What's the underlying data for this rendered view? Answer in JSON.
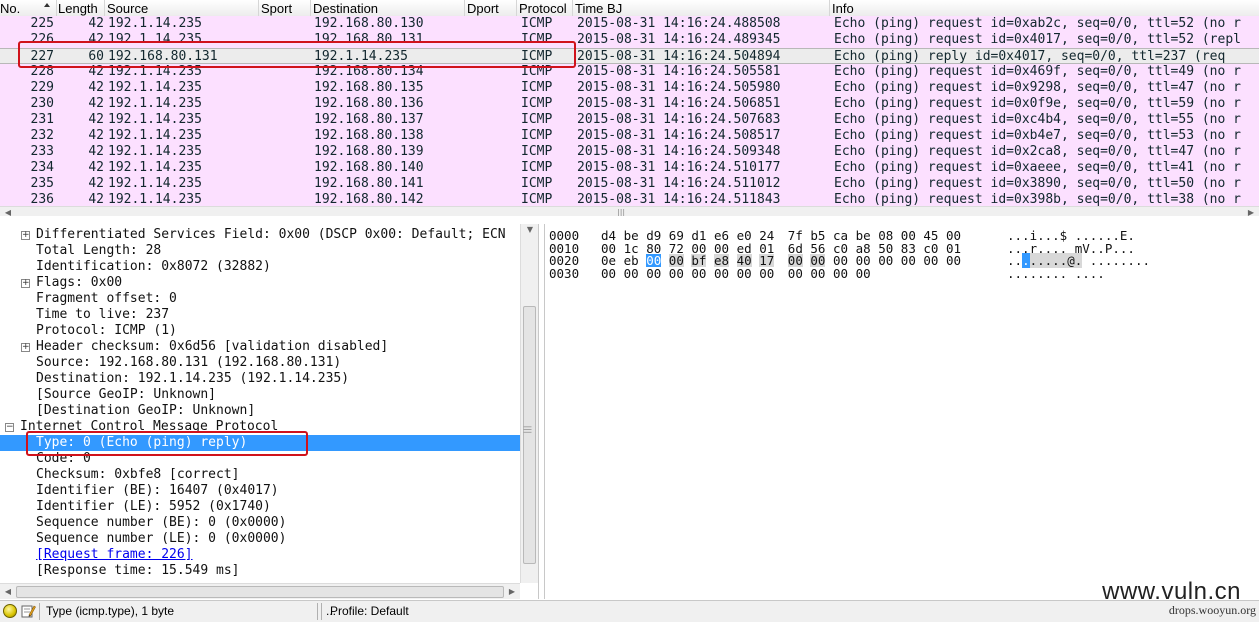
{
  "packet_list": {
    "columns": [
      "No.",
      "Length",
      "Source",
      "Sport",
      "Destination",
      "Dport",
      "Protocol",
      "Time BJ",
      "Info"
    ],
    "rows": [
      {
        "no": "225",
        "len": "42",
        "src": "192.1.14.235",
        "dst": "192.168.80.130",
        "proto": "ICMP",
        "time": "2015-08-31 14:16:24.488508",
        "info": "Echo (ping) request  id=0xab2c, seq=0/0, ttl=52 (no r"
      },
      {
        "no": "226",
        "len": "42",
        "src": "192.1.14.235",
        "dst": "192.168.80.131",
        "proto": "ICMP",
        "time": "2015-08-31 14:16:24.489345",
        "info": "Echo (ping) request  id=0x4017, seq=0/0, ttl=52 (repl"
      },
      {
        "no": "227",
        "len": "60",
        "src": "192.168.80.131",
        "dst": "192.1.14.235",
        "proto": "ICMP",
        "time": "2015-08-31 14:16:24.504894",
        "info": "Echo (ping) reply    id=0x4017, seq=0/0, ttl=237 (req"
      },
      {
        "no": "228",
        "len": "42",
        "src": "192.1.14.235",
        "dst": "192.168.80.134",
        "proto": "ICMP",
        "time": "2015-08-31 14:16:24.505581",
        "info": "Echo (ping) request  id=0x469f, seq=0/0, ttl=49 (no r"
      },
      {
        "no": "229",
        "len": "42",
        "src": "192.1.14.235",
        "dst": "192.168.80.135",
        "proto": "ICMP",
        "time": "2015-08-31 14:16:24.505980",
        "info": "Echo (ping) request  id=0x9298, seq=0/0, ttl=47 (no r"
      },
      {
        "no": "230",
        "len": "42",
        "src": "192.1.14.235",
        "dst": "192.168.80.136",
        "proto": "ICMP",
        "time": "2015-08-31 14:16:24.506851",
        "info": "Echo (ping) request  id=0x0f9e, seq=0/0, ttl=59 (no r"
      },
      {
        "no": "231",
        "len": "42",
        "src": "192.1.14.235",
        "dst": "192.168.80.137",
        "proto": "ICMP",
        "time": "2015-08-31 14:16:24.507683",
        "info": "Echo (ping) request  id=0xc4b4, seq=0/0, ttl=55 (no r"
      },
      {
        "no": "232",
        "len": "42",
        "src": "192.1.14.235",
        "dst": "192.168.80.138",
        "proto": "ICMP",
        "time": "2015-08-31 14:16:24.508517",
        "info": "Echo (ping) request  id=0xb4e7, seq=0/0, ttl=53 (no r"
      },
      {
        "no": "233",
        "len": "42",
        "src": "192.1.14.235",
        "dst": "192.168.80.139",
        "proto": "ICMP",
        "time": "2015-08-31 14:16:24.509348",
        "info": "Echo (ping) request  id=0x2ca8, seq=0/0, ttl=47 (no r"
      },
      {
        "no": "234",
        "len": "42",
        "src": "192.1.14.235",
        "dst": "192.168.80.140",
        "proto": "ICMP",
        "time": "2015-08-31 14:16:24.510177",
        "info": "Echo (ping) request  id=0xaeee, seq=0/0, ttl=41 (no r"
      },
      {
        "no": "235",
        "len": "42",
        "src": "192.1.14.235",
        "dst": "192.168.80.141",
        "proto": "ICMP",
        "time": "2015-08-31 14:16:24.511012",
        "info": "Echo (ping) request  id=0x3890, seq=0/0, ttl=50 (no r"
      },
      {
        "no": "236",
        "len": "42",
        "src": "192.1.14.235",
        "dst": "192.168.80.142",
        "proto": "ICMP",
        "time": "2015-08-31 14:16:24.511843",
        "info": "Echo (ping) request  id=0x398b, seq=0/0, ttl=38 (no r"
      }
    ],
    "selected_row": "227",
    "row_color": "#fce0ff"
  },
  "details": {
    "lines": [
      {
        "text": "Differentiated Services Field: 0x00 (DSCP 0x00: Default; ECN",
        "expander": "+",
        "level": 1
      },
      {
        "text": "Total Length: 28",
        "level": 1
      },
      {
        "text": "Identification: 0x8072 (32882)",
        "level": 1
      },
      {
        "text": "Flags: 0x00",
        "expander": "+",
        "level": 1
      },
      {
        "text": "Fragment offset: 0",
        "level": 1
      },
      {
        "text": "Time to live: 237",
        "level": 1
      },
      {
        "text": "Protocol: ICMP (1)",
        "level": 1
      },
      {
        "text": "Header checksum: 0x6d56 [validation disabled]",
        "expander": "+",
        "level": 1
      },
      {
        "text": "Source: 192.168.80.131 (192.168.80.131)",
        "level": 1
      },
      {
        "text": "Destination: 192.1.14.235 (192.1.14.235)",
        "level": 1
      },
      {
        "text": "[Source GeoIP: Unknown]",
        "level": 1
      },
      {
        "text": "[Destination GeoIP: Unknown]",
        "level": 1
      },
      {
        "text": "Internet Control Message Protocol",
        "expander": "−",
        "level": 0
      },
      {
        "text": "Type: 0 (Echo (ping) reply)",
        "level": 1,
        "highlight": true
      },
      {
        "text": "Code: 0",
        "level": 1
      },
      {
        "text": "Checksum: 0xbfe8 [correct]",
        "level": 1
      },
      {
        "text": "Identifier (BE): 16407 (0x4017)",
        "level": 1
      },
      {
        "text": "Identifier (LE): 5952 (0x1740)",
        "level": 1
      },
      {
        "text": "Sequence number (BE): 0 (0x0000)",
        "level": 1
      },
      {
        "text": "Sequence number (LE): 0 (0x0000)",
        "level": 1
      },
      {
        "text": "[Request frame: 226]",
        "level": 1,
        "link": true
      },
      {
        "text": "[Response time: 15.549 ms]",
        "level": 1
      }
    ]
  },
  "bytes": {
    "lines": [
      {
        "offset": "0000",
        "hex": [
          "d4",
          "be",
          "d9",
          "69",
          "d1",
          "e6",
          "e0",
          "24",
          "7f",
          "b5",
          "ca",
          "be",
          "08",
          "00",
          "45",
          "00"
        ],
        "ascii": "...i...$ ......E."
      },
      {
        "offset": "0010",
        "hex": [
          "00",
          "1c",
          "80",
          "72",
          "00",
          "00",
          "ed",
          "01",
          "6d",
          "56",
          "c0",
          "a8",
          "50",
          "83",
          "c0",
          "01"
        ],
        "ascii": "...r.... mV..P..."
      },
      {
        "offset": "0020",
        "hex": [
          "0e",
          "eb",
          "00",
          "00",
          "bf",
          "e8",
          "40",
          "17",
          "00",
          "00",
          "00",
          "00",
          "00",
          "00",
          "00",
          "00"
        ],
        "ascii": "........@. ........"
      },
      {
        "offset": "0030",
        "hex": [
          "00",
          "00",
          "00",
          "00",
          "00",
          "00",
          "00",
          "00",
          "00",
          "00",
          "00",
          "00"
        ],
        "ascii": "........ ...."
      }
    ],
    "selected_byte": {
      "line": 2,
      "index": 2
    },
    "highlighted_bytes": {
      "line": 2,
      "from": 3,
      "to": 9
    }
  },
  "status": {
    "field_info": "Type (icmp.type), 1 byte",
    "packets_info": "...",
    "profile": "Profile: Default"
  },
  "watermark": {
    "main": "www.vuln.cn",
    "sub": "drops.wooyun.org"
  },
  "colors": {
    "packet_row_bg": "#fce0ff",
    "selection_blue": "#3399ff",
    "annotation_red": "#d0121b"
  }
}
